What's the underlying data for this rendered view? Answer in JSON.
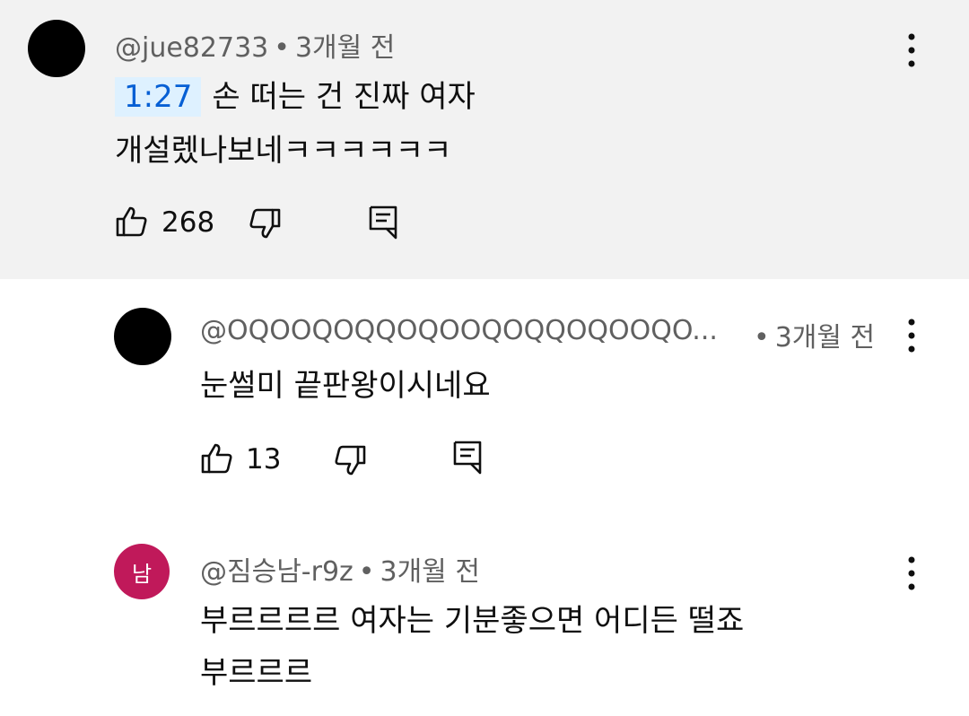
{
  "comments": [
    {
      "handle": "@jue82733",
      "time": "3개월 전",
      "timestamp_link": "1:27",
      "line1": "손 떠는 건 진짜 여자",
      "line2": "개설렜나보네ㅋㅋㅋㅋㅋㅋ",
      "likes": "268",
      "avatar": "black-circle"
    },
    {
      "handle": "@OQOOQOQQOQOOQOQQOQOOQO...",
      "time": "3개월 전",
      "line1": "눈썰미 끝판왕이시네요",
      "likes": "13",
      "avatar": "black-circle"
    },
    {
      "handle": "@짐승남-r9z",
      "time": "3개월 전",
      "avatar_letter": "남",
      "line1": "부르르르르 여자는 기분좋으면 어디든 떨죠",
      "line2": "부르르르",
      "avatar_color": "#c0195a"
    }
  ],
  "colors": {
    "highlight_bg": "#f2f2f2",
    "timestamp_text": "#065fd4",
    "timestamp_bg": "#def1ff",
    "meta_text": "#606060"
  },
  "icons": [
    "like-icon",
    "dislike-icon",
    "reply-icon",
    "more-options-icon"
  ],
  "separator": "•"
}
